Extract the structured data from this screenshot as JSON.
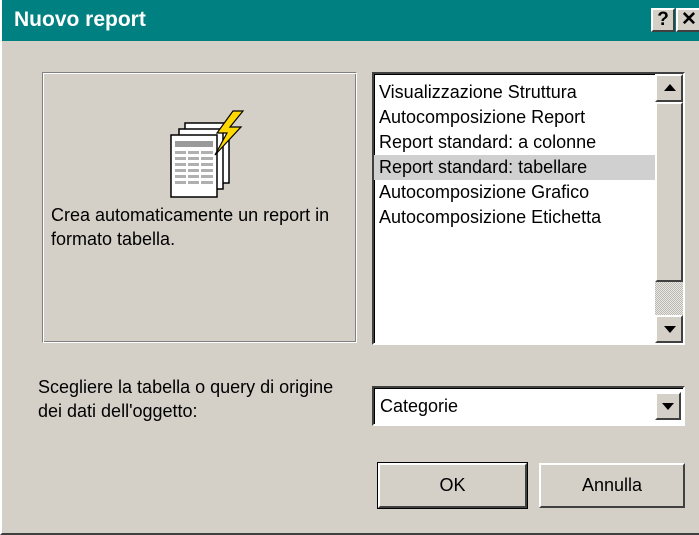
{
  "dialog": {
    "title": "Nuovo report",
    "help_button": "?",
    "close_button": "✕"
  },
  "preview": {
    "icon": "report-table-wizard-icon",
    "description": "Crea automaticamente un report in formato tabella."
  },
  "report_types": {
    "items": [
      "Visualizzazione Struttura",
      "Autocomposizione Report",
      "Report standard: a colonne",
      "Report standard: tabellare",
      "Autocomposizione Grafico",
      "Autocomposizione Etichetta"
    ],
    "selected": "Report standard: tabellare"
  },
  "source": {
    "label": "Scegliere la tabella o query di origine dei dati dell'oggetto:",
    "value": "Categorie"
  },
  "buttons": {
    "ok": "OK",
    "cancel": "Annulla"
  },
  "colors": {
    "titlebar": "#008080",
    "face": "#d4d0c8",
    "selection": "#d0d0d0",
    "lightning": "#ffd800"
  }
}
